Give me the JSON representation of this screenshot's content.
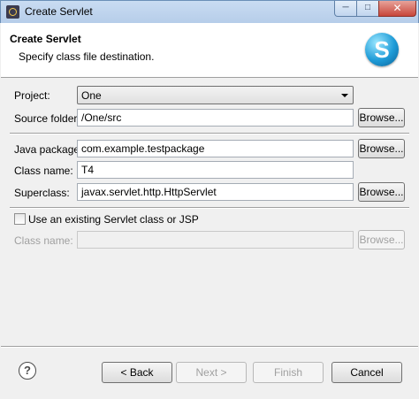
{
  "window": {
    "title": "Create Servlet",
    "min_glyph": "─",
    "max_glyph": "□",
    "close_glyph": "✕",
    "app_icon": "eclipse-icon"
  },
  "header": {
    "title": "Create Servlet",
    "description": "Specify class file destination.",
    "logo_letter": "S",
    "logo_icon": "servlet-logo-icon"
  },
  "form": {
    "project": {
      "label": "Project:",
      "value": "One"
    },
    "source_folder": {
      "label": "Source folder:",
      "value": "/One/src",
      "browse": "Browse..."
    },
    "java_package": {
      "label": "Java package:",
      "value": "com.example.testpackage",
      "browse": "Browse..."
    },
    "class_name": {
      "label": "Class name:",
      "value": "T4"
    },
    "superclass": {
      "label": "Superclass:",
      "value": "javax.servlet.http.HttpServlet",
      "browse": "Browse..."
    },
    "existing": {
      "label": "Use an existing Servlet class or JSP",
      "checked": false
    },
    "existing_class": {
      "label": "Class name:",
      "value": "",
      "browse": "Browse..."
    }
  },
  "footer": {
    "help_glyph": "?",
    "back": "< Back",
    "next": "Next >",
    "finish": "Finish",
    "cancel": "Cancel"
  },
  "colors": {
    "titlebar": "#c9dcf2",
    "close": "#c7463a",
    "logo": "#1e9bd7",
    "disabled_text": "#a0a0a0"
  }
}
